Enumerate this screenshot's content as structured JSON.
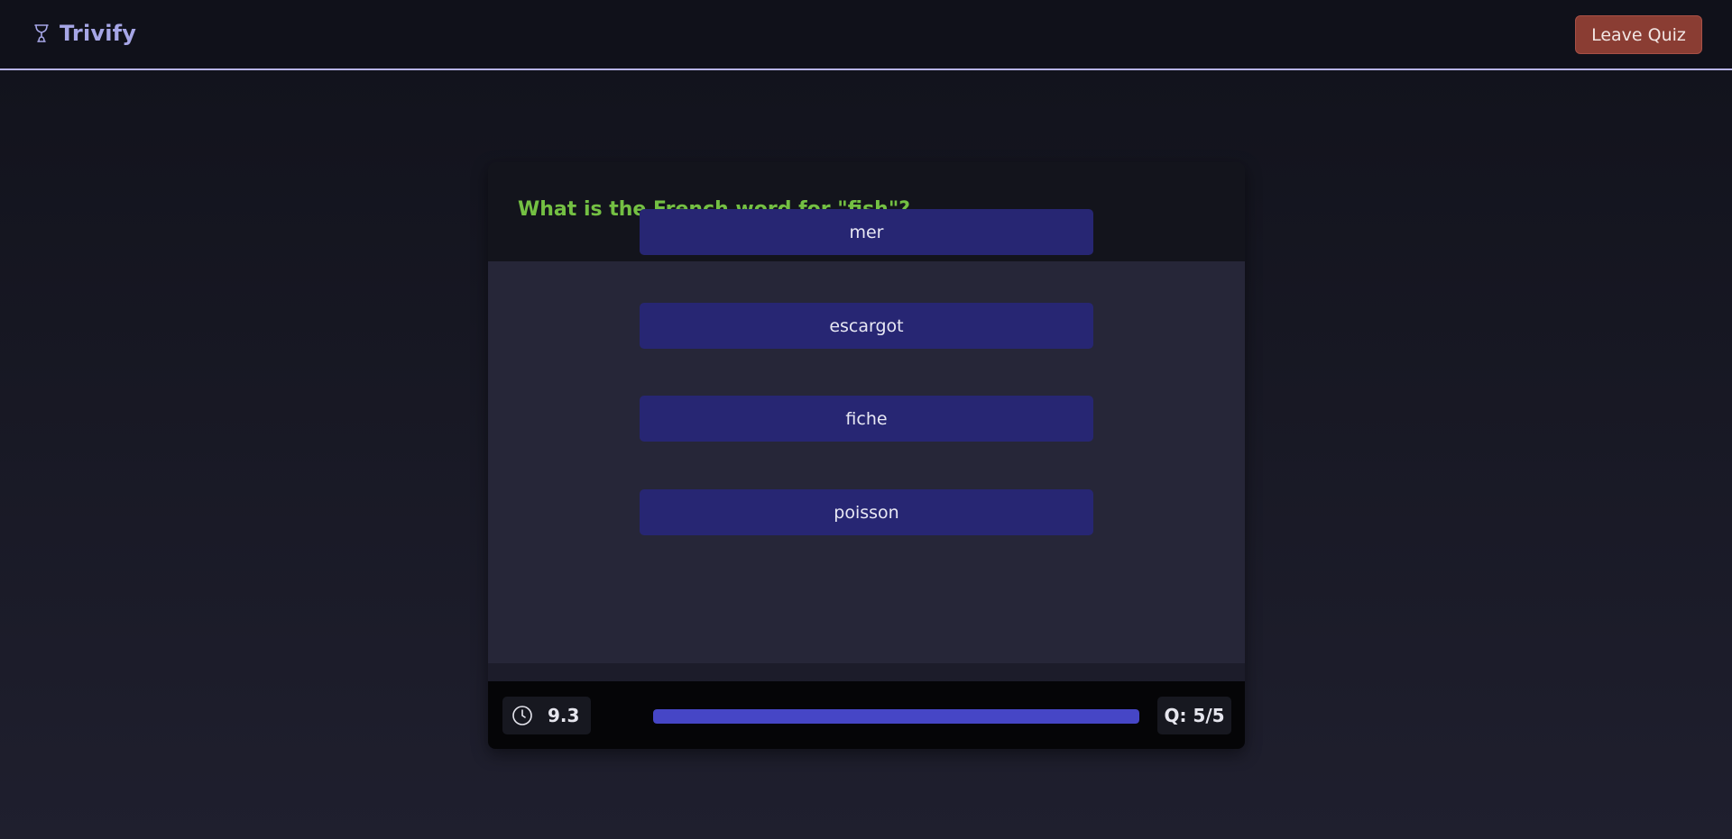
{
  "app": {
    "name": "Trivify",
    "brand_icon": "trophy-icon",
    "brand_color": "#a6a6e6"
  },
  "header": {
    "leave_label": "Leave Quiz",
    "leave_color": "#8a3d33"
  },
  "quiz": {
    "question": "What is the French word for \"fish\"?",
    "question_color": "#74c043",
    "answers": [
      {
        "label": "mer"
      },
      {
        "label": "escargot"
      },
      {
        "label": "fiche"
      },
      {
        "label": "poisson"
      }
    ],
    "answer_color": "#272673"
  },
  "status": {
    "timer_icon": "clock-icon",
    "timer_value": "9.3",
    "progress": 1.0,
    "progress_color": "#4646c6",
    "question_counter": "Q: 5/5"
  }
}
